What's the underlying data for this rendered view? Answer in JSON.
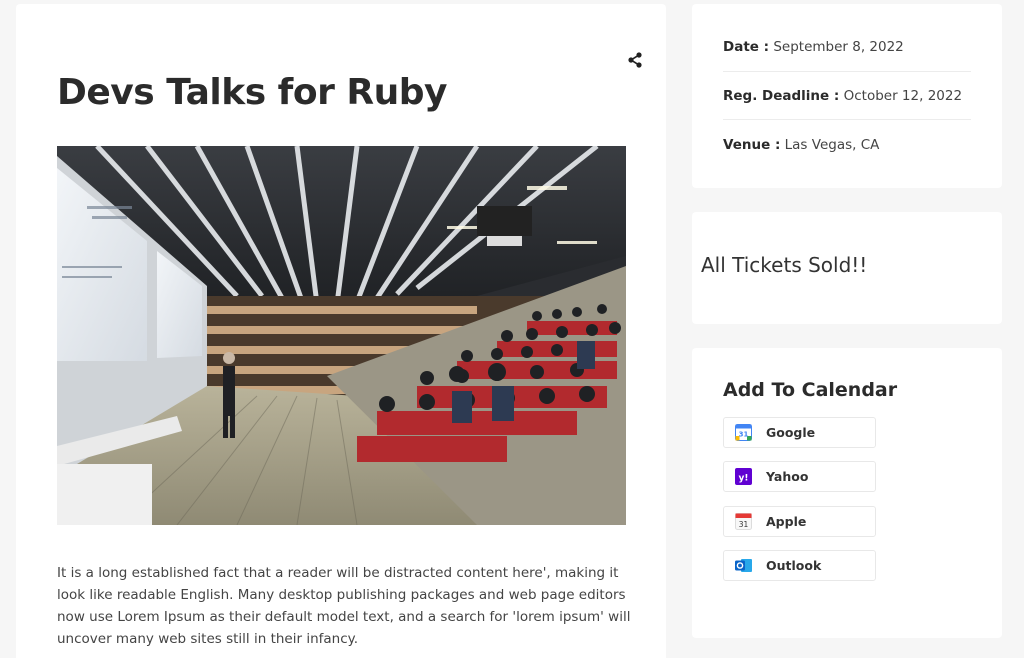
{
  "event": {
    "title": "Devs Talks for Ruby",
    "description": "It is a long established fact that a reader will be distracted content here', making it look like readable English. Many desktop publishing packages and web page editors now use Lorem Ipsum as their default model text, and a search for 'lorem ipsum' will uncover many web sites still in their infancy.",
    "share_icon": "share-icon",
    "image_icon": "lecture-hall-photo"
  },
  "info": {
    "date_label": "Date :",
    "date_value": "September 8, 2022",
    "deadline_label": "Reg. Deadline :",
    "deadline_value": "October 12, 2022",
    "venue_label": "Venue :",
    "venue_value": "Las Vegas, CA"
  },
  "tickets": {
    "status": "All Tickets Sold!!"
  },
  "calendar": {
    "title": "Add To Calendar",
    "buttons": [
      {
        "label": "Google",
        "icon": "google-calendar-icon",
        "color": "#4285f4"
      },
      {
        "label": "Yahoo",
        "icon": "yahoo-icon",
        "color": "#6001d2"
      },
      {
        "label": "Apple",
        "icon": "apple-calendar-icon",
        "color": "#e53935"
      },
      {
        "label": "Outlook",
        "icon": "outlook-icon",
        "color": "#0a64c8"
      }
    ]
  }
}
